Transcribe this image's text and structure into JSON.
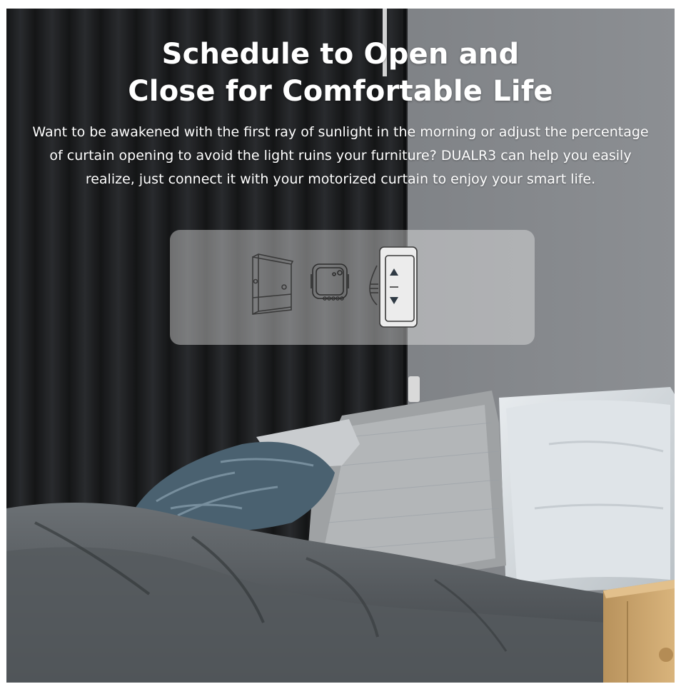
{
  "hero": {
    "title_line1": "Schedule to Open and",
    "title_line2": "Close for Comfortable Life",
    "description": "Want to be awakened with the first ray of sunlight in the morning or adjust the percentage of curtain opening to avoid the light ruins your furniture? DUALR3 can help you easily realize, just connect it with your motorized curtain to enjoy your smart life."
  },
  "installation_panel": {
    "items": [
      "wall-box-icon",
      "switch-module-icon",
      "curtain-switch-icon"
    ]
  },
  "colors": {
    "title_text": "#ffffff",
    "curtain_dark": "#1c1d1f",
    "wall_gray": "#797c80",
    "bedding_gray": "#5d6266",
    "pillow_blue": "#4a6170",
    "nightstand_wood": "#c9a56e"
  }
}
